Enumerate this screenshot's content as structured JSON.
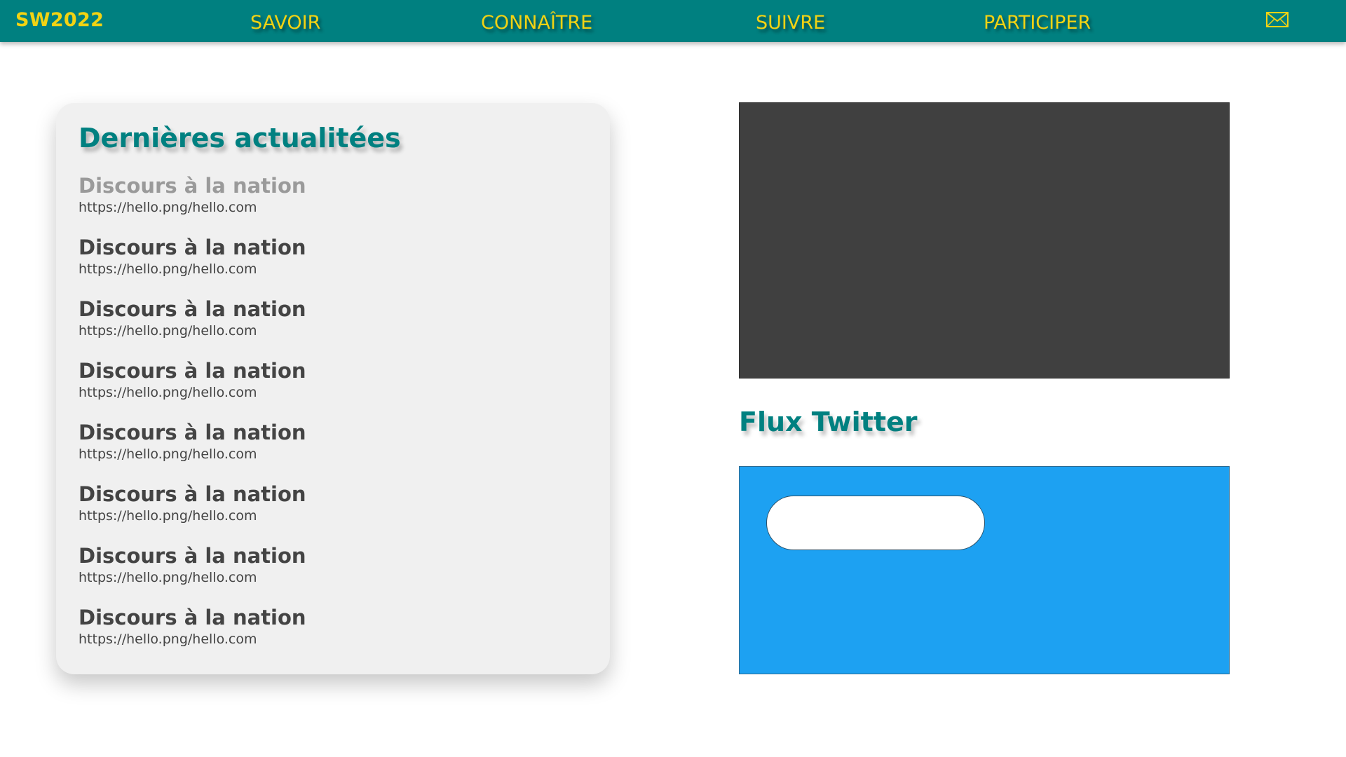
{
  "header": {
    "brand": "SW2022",
    "nav": [
      {
        "label": "SAVOIR"
      },
      {
        "label": "CONNAÎTRE"
      },
      {
        "label": "SUIVRE"
      },
      {
        "label": "PARTICIPER"
      }
    ],
    "mail_icon": "envelope-icon",
    "colors": {
      "bar": "#008080",
      "text": "#f2d313"
    }
  },
  "news": {
    "title": "Dernières actualitées",
    "items": [
      {
        "title": "Discours à la nation",
        "url": "https://hello.png/hello.com"
      },
      {
        "title": "Discours à la nation",
        "url": "https://hello.png/hello.com"
      },
      {
        "title": "Discours à la nation",
        "url": "https://hello.png/hello.com"
      },
      {
        "title": "Discours à la nation",
        "url": "https://hello.png/hello.com"
      },
      {
        "title": "Discours à la nation",
        "url": "https://hello.png/hello.com"
      },
      {
        "title": "Discours à la nation",
        "url": "https://hello.png/hello.com"
      },
      {
        "title": "Discours à la nation",
        "url": "https://hello.png/hello.com"
      },
      {
        "title": "Discours à la nation",
        "url": "https://hello.png/hello.com"
      }
    ]
  },
  "twitter": {
    "heading": "Flux Twitter",
    "colors": {
      "background": "#1da1f2"
    }
  }
}
